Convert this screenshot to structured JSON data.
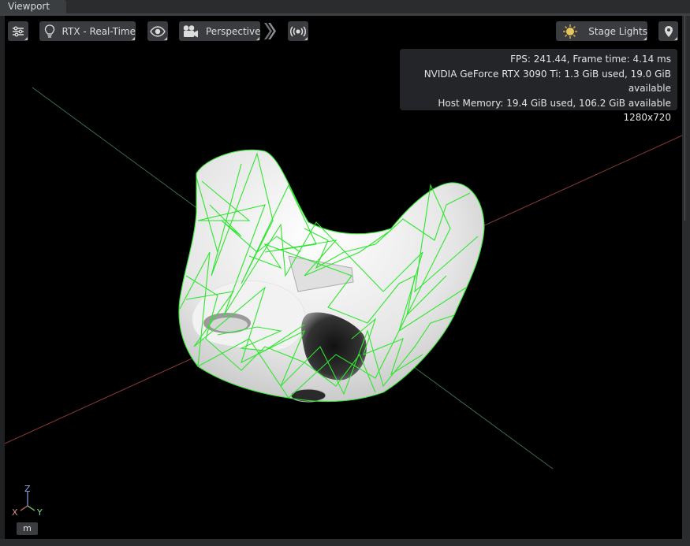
{
  "window": {
    "tab_title": "Viewport"
  },
  "toolbar": {
    "settings_icon": "sliders-icon",
    "render_mode": {
      "icon": "lightbulb-icon",
      "label": "RTX - Real-Time"
    },
    "visibility_icon": "eye-icon",
    "camera": {
      "icon": "camera-icon",
      "label": "Perspective"
    },
    "expand_icon": "double-chevron-right-icon",
    "broadcast_icon": "broadcast-icon",
    "lighting": {
      "icon": "sun-icon",
      "label": "Stage Lights"
    },
    "pin_icon": "map-pin-icon"
  },
  "stats": {
    "fps_line": "FPS: 241.44, Frame time: 4.14 ms",
    "gpu_line": "NVIDIA GeForce RTX 3090 Ti: 1.3 GiB used, 19.0 GiB available",
    "host_line": "Host Memory: 19.4 GiB used, 106.2 GiB available",
    "resolution_line": "1280x720"
  },
  "gizmo": {
    "z": "Z",
    "x": "X",
    "y": "Y"
  },
  "units_label": "m",
  "colors": {
    "wireframe": "#2ee62e",
    "x_axis": "#8a3a3a",
    "z_axis": "#3e6b4a",
    "mesh": "#e8e8e8"
  }
}
